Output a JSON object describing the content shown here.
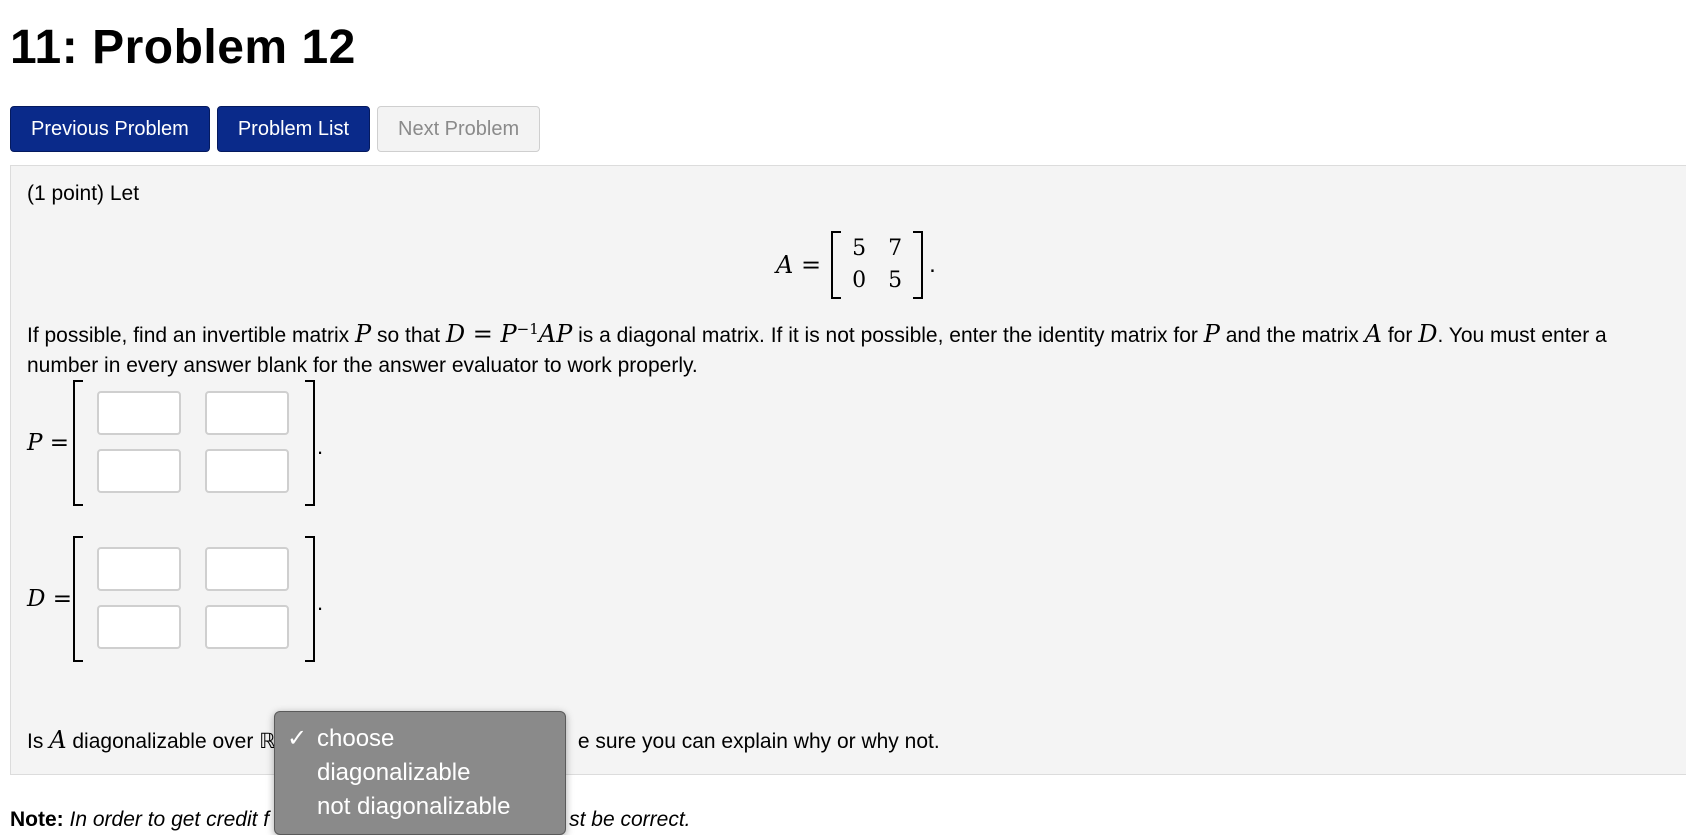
{
  "page_title": "11: Problem 12",
  "nav": {
    "previous": "Previous Problem",
    "list": "Problem List",
    "next": "Next Problem"
  },
  "problem": {
    "intro": "(1 point) Let",
    "matrix_A_label": "A =",
    "matrix_A": [
      [
        "5",
        "7"
      ],
      [
        "0",
        "5"
      ]
    ],
    "matrix_A_end": ".",
    "desc_1": "If possible, find an invertible matrix",
    "P": "P",
    "desc_2": "so that",
    "equation": "D = P",
    "superscript": "−1",
    "equation_tail": "AP",
    "desc_3": "is a diagonal matrix. If it is not possible, enter the identity matrix for",
    "desc_4": "and the matrix",
    "A": "A",
    "desc_5": "for",
    "D": "D",
    "desc_6": ". You must enter a number in every answer blank for the answer evaluator to work properly.",
    "P_label": "P =",
    "D_label": "D =",
    "matrix_end": ".",
    "diag_q_1": "Is",
    "diag_q_2": "diagonalizable over ℝ",
    "diag_q_3": "e sure you can explain why or why not."
  },
  "dropdown": {
    "options": [
      "choose",
      "diagonalizable",
      "not diagonalizable"
    ],
    "selected": "choose",
    "check": "✓"
  },
  "note": {
    "label": "Note:",
    "text_left": "In order to get credit f",
    "text_right": "st be correct."
  }
}
